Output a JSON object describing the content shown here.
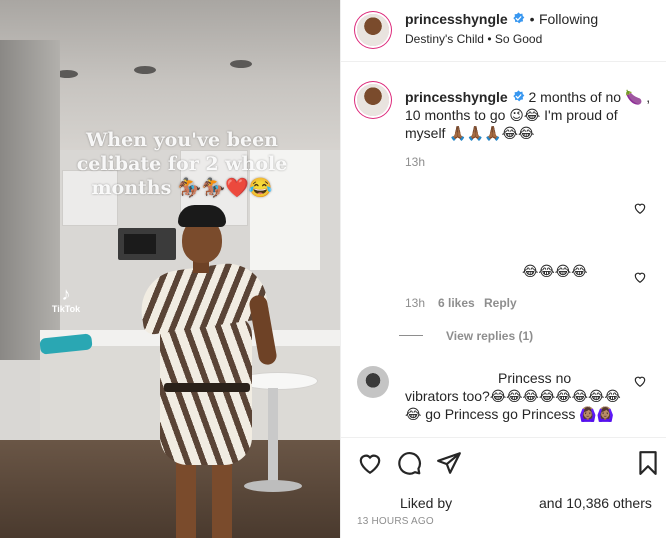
{
  "media": {
    "overlay_text": "When you've been celibate for 2 whole months 🏇🏇❤️😂",
    "watermark_label": "TikTok",
    "watermark_icon": "tiktok-note-icon"
  },
  "header": {
    "username": "princesshyngle",
    "separator": "•",
    "follow_status": "Following",
    "audio_artist": "Destiny's Child",
    "audio_separator": "•",
    "audio_track": "So Good"
  },
  "caption": {
    "username": "princesshyngle",
    "line1": "2 months of no 🍆 ,",
    "line2": "10 months to go 😉😂 I'm proud of",
    "line3": "myself 🙏🏾🙏🏾🙏🏾😂😂",
    "time": "13h"
  },
  "comment1": {
    "text": "😂😂😂😂",
    "time": "13h",
    "likes": "6 likes",
    "reply": "Reply",
    "view_replies": "View replies (1)"
  },
  "comment2": {
    "line1": "Princess no",
    "line2": "vibrators too?😂😂😂😂😂😂😂😂",
    "line3": "😂 go Princess go Princess 🙆🏽‍♀️🙆🏽‍♀️"
  },
  "footer": {
    "liked_by": "Liked by",
    "others": "and 10,386 others",
    "posted": "13 HOURS AGO"
  },
  "colors": {
    "verified": "#3897f0",
    "muted": "#8e8e8e",
    "text": "#262626",
    "story_ring": "#dd2a7b"
  }
}
